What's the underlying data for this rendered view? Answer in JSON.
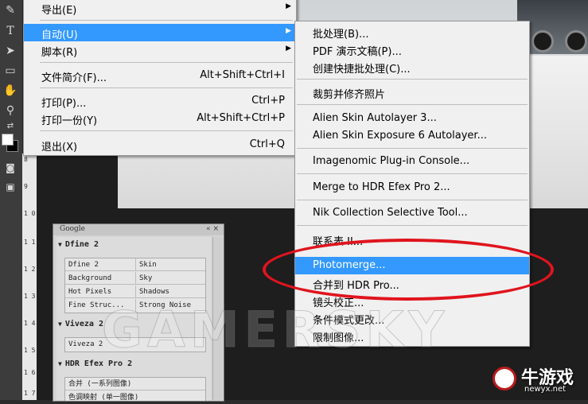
{
  "file_menu": {
    "items": [
      {
        "label": "导出(E)",
        "shortcut": "",
        "has_submenu": true,
        "highlighted": false
      },
      {
        "label": "自动(U)",
        "shortcut": "",
        "has_submenu": true,
        "highlighted": true
      },
      {
        "label": "脚本(R)",
        "shortcut": "",
        "has_submenu": true,
        "highlighted": false
      },
      {
        "label": "文件简介(F)...",
        "shortcut": "Alt+Shift+Ctrl+I",
        "has_submenu": false,
        "highlighted": false
      },
      {
        "label": "打印(P)...",
        "shortcut": "Ctrl+P",
        "has_submenu": false,
        "highlighted": false
      },
      {
        "label": "打印一份(Y)",
        "shortcut": "Alt+Shift+Ctrl+P",
        "has_submenu": false,
        "highlighted": false
      },
      {
        "label": "退出(X)",
        "shortcut": "Ctrl+Q",
        "has_submenu": false,
        "highlighted": false
      }
    ]
  },
  "automate_menu": {
    "items": [
      {
        "label": "批处理(B)..."
      },
      {
        "label": "PDF 演示文稿(P)..."
      },
      {
        "label": "创建快捷批处理(C)..."
      },
      {
        "label": "裁剪并修齐照片"
      },
      {
        "label": "Alien Skin Autolayer 3..."
      },
      {
        "label": "Alien Skin Exposure 6 Autolayer..."
      },
      {
        "label": "Imagenomic Plug-in Console..."
      },
      {
        "label": "Merge to HDR Efex Pro 2..."
      },
      {
        "label": "Nik Collection Selective Tool..."
      },
      {
        "label": "联系表 II..."
      },
      {
        "label": "Photomerge...",
        "highlighted": true
      },
      {
        "label": "合并到 HDR Pro..."
      },
      {
        "label": "镜头校正..."
      },
      {
        "label": "条件模式更改..."
      },
      {
        "label": "限制图像..."
      }
    ]
  },
  "ruler": {
    "marks": [
      "8",
      "9",
      "1 0",
      "1 1",
      "1 2",
      "1 3",
      "1 4",
      "1 5",
      "1 6",
      "1 7"
    ]
  },
  "google_panel": {
    "title": "Google",
    "controls": "«  ×",
    "sections": [
      {
        "name": "Dfine 2",
        "cells": [
          [
            "Dfine 2",
            "Skin"
          ],
          [
            "Background",
            "Sky"
          ],
          [
            "Hot Pixels",
            "Shadows"
          ],
          [
            "Fine Struc...",
            "Strong Noise"
          ]
        ]
      },
      {
        "name": "Viveza 2",
        "cells": [
          [
            "Viveza 2",
            ""
          ]
        ]
      },
      {
        "name": "HDR Efex Pro 2",
        "cells": [
          [
            "合并 (一系列图像)",
            ""
          ],
          [
            "色调映射 (单一图像)",
            ""
          ]
        ]
      }
    ]
  },
  "watermark": "GAMERSKY",
  "logo": {
    "name": "牛游戏",
    "url": "newyx.net"
  },
  "colors": {
    "menu_bg": "#f0f0f0",
    "highlight": "#3399ff",
    "annotation": "#e0141e"
  },
  "icons": [
    "pen-icon",
    "type-icon",
    "path-select-icon",
    "rectangle-icon",
    "hand-icon",
    "zoom-icon",
    "swap-colors-icon",
    "quick-mask-icon",
    "screen-mode-icon"
  ]
}
